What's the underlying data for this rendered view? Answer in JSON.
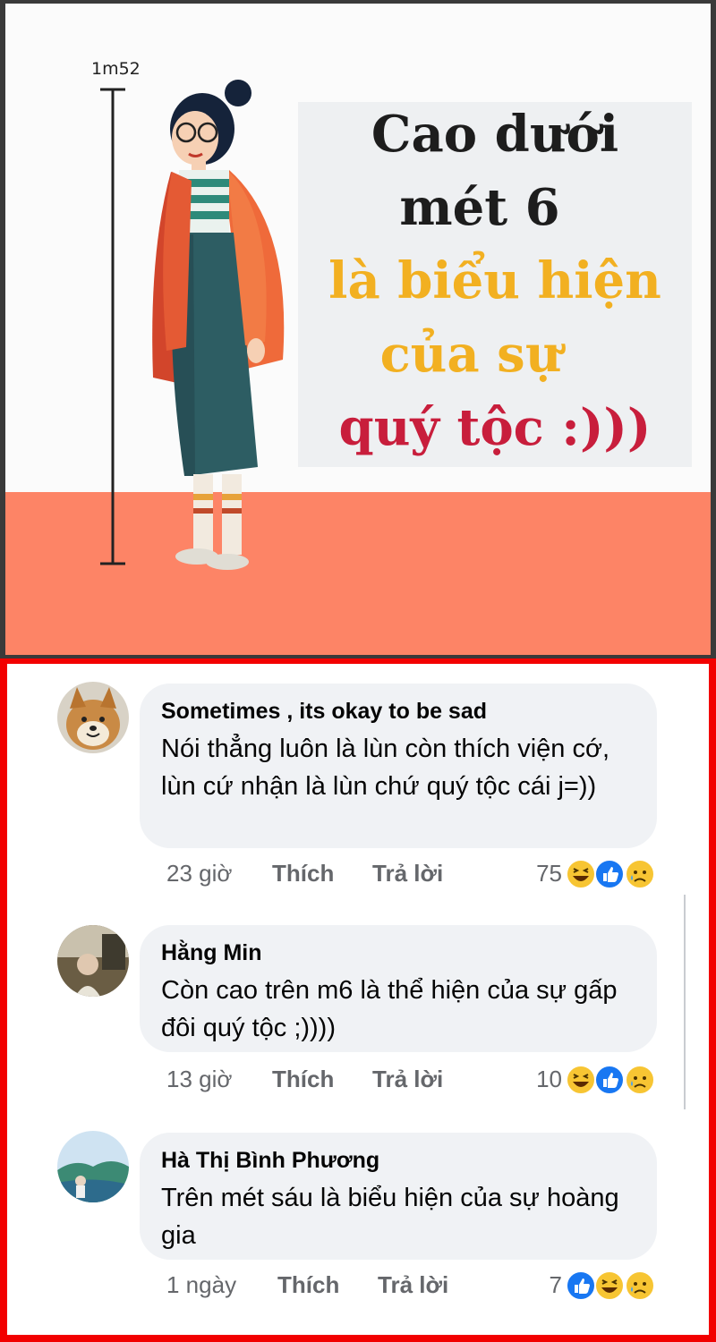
{
  "meme": {
    "measure_label": "1m52",
    "lines": [
      "Cao dưới",
      "mét 6",
      "là biểu hiện",
      "của sự",
      "quý tộc :)))"
    ]
  },
  "comments": [
    {
      "author": "Sometimes , its okay to be sad",
      "text": "Nói thẳng luôn là lùn còn thích viện cớ, lùn cứ nhận là lùn chứ quý tộc cái j=))",
      "time": "23 giờ",
      "like_label": "Thích",
      "reply_label": "Trả lời",
      "reaction_count": "75",
      "reactions": [
        "haha-icon",
        "like-icon",
        "sad-icon"
      ]
    },
    {
      "author": "Hằng Min",
      "text": "Còn cao trên m6 là thể hiện của sự gấp đôi quý tộc ;))))",
      "time": "13 giờ",
      "like_label": "Thích",
      "reply_label": "Trả lời",
      "reaction_count": "10",
      "reactions": [
        "haha-icon",
        "like-icon",
        "sad-icon"
      ]
    },
    {
      "author": "Hà Thị Bình Phương",
      "text": "Trên mét sáu là biểu hiện của sự hoàng gia",
      "time": "1 ngày",
      "like_label": "Thích",
      "reply_label": "Trả lời",
      "reaction_count": "7",
      "reactions": [
        "like-icon",
        "haha-icon",
        "sad-icon"
      ]
    }
  ],
  "colors": {
    "highlight_border": "#f20000",
    "floor": "#fd8466",
    "title_dark": "#1d1d1d",
    "title_yellow": "#f2b021",
    "title_red": "#c81e3c",
    "bubble": "#f0f2f5",
    "meta_gray": "#65676b",
    "like_blue": "#1877f2"
  }
}
